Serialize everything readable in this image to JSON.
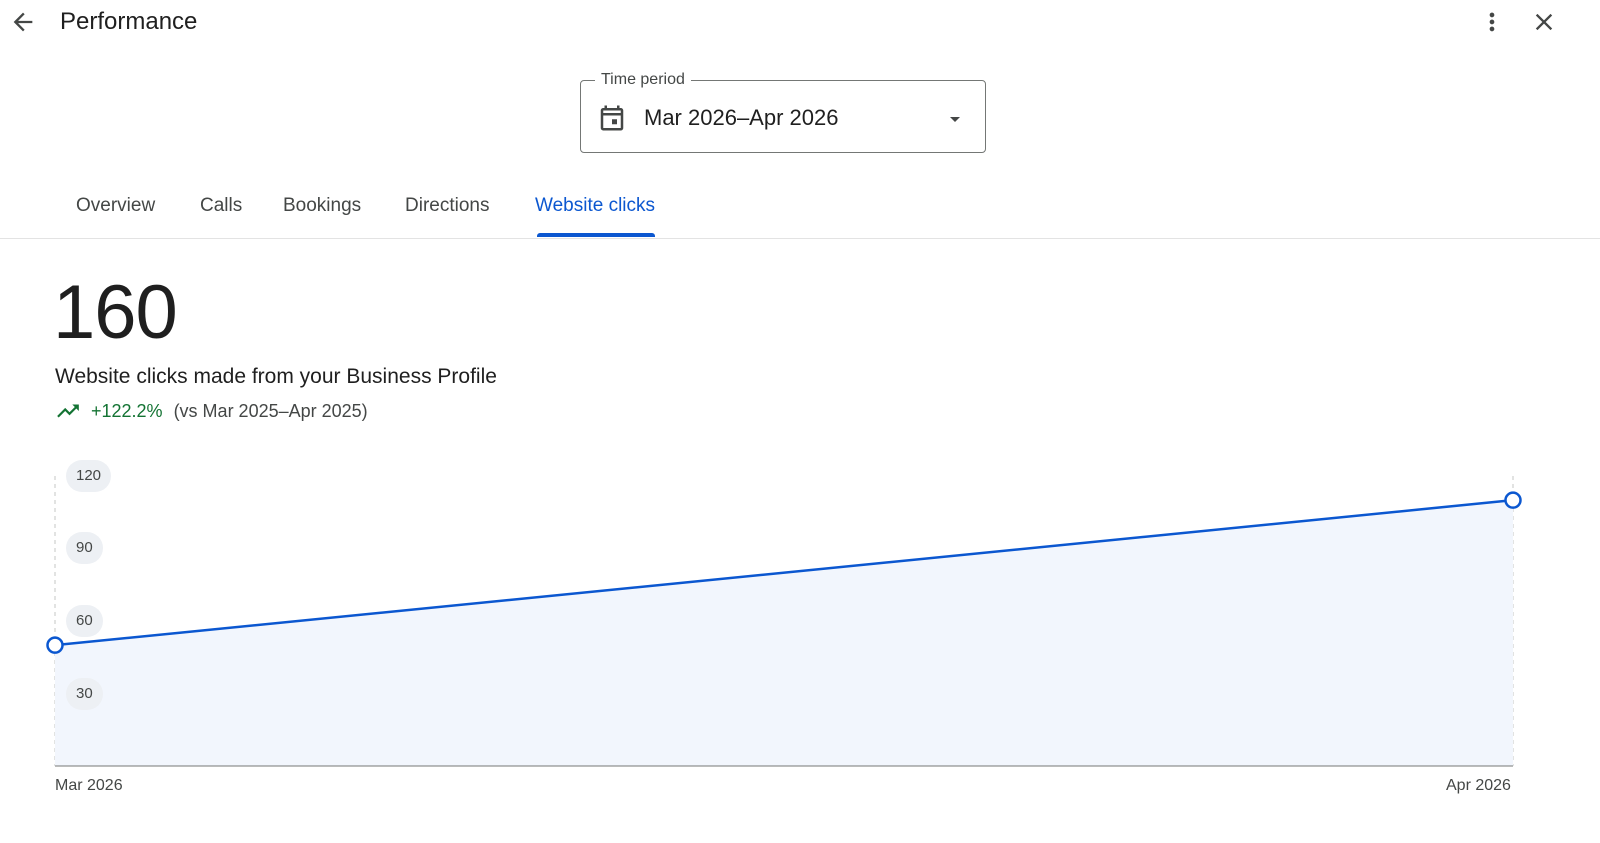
{
  "header": {
    "title": "Performance",
    "back_icon": "arrow-back-icon",
    "more_icon": "more-vert-icon",
    "close_icon": "close-icon"
  },
  "time_period": {
    "label": "Time period",
    "value": "Mar 2026–Apr 2026",
    "icon": "calendar-icon"
  },
  "tabs": [
    {
      "label": "Overview",
      "active": false
    },
    {
      "label": "Calls",
      "active": false
    },
    {
      "label": "Bookings",
      "active": false
    },
    {
      "label": "Directions",
      "active": false
    },
    {
      "label": "Website clicks",
      "active": true
    }
  ],
  "metric": {
    "value": "160",
    "description": "Website clicks made from your Business Profile",
    "change": "+122.2%",
    "comparison": "(vs Mar 2025–Apr 2025)",
    "trend_icon": "trending-up-icon"
  },
  "colors": {
    "accent": "#0b57d0",
    "positive": "#137333",
    "area_fill": "#f2f6fd"
  },
  "chart_data": {
    "type": "area",
    "categories": [
      "Mar 2026",
      "Apr 2026"
    ],
    "series": [
      {
        "values": [
          50,
          110
        ]
      }
    ],
    "y_ticks": [
      "120",
      "90",
      "60",
      "30"
    ],
    "ylim": [
      0,
      120
    ],
    "grid": false
  }
}
